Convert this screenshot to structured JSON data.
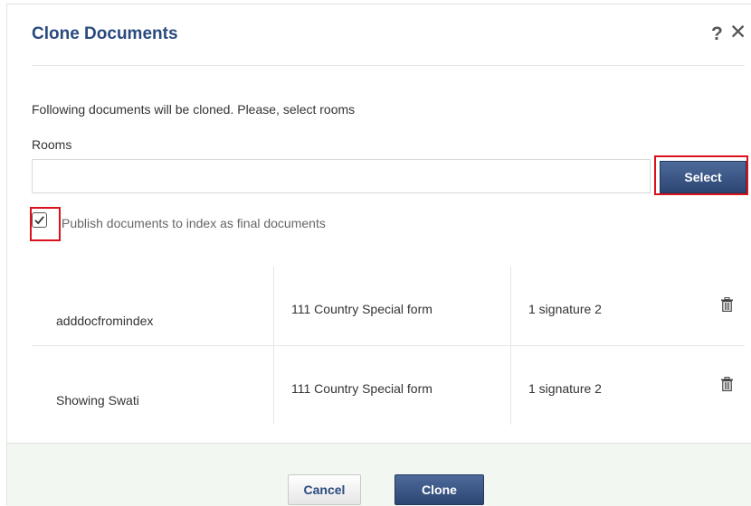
{
  "dialog": {
    "title": "Clone Documents",
    "help_glyph": "?",
    "close_glyph": "✕"
  },
  "instruction": "Following documents will be cloned. Please, select rooms",
  "rooms": {
    "label": "Rooms",
    "value": "",
    "placeholder": "",
    "select_label": "Select"
  },
  "publish": {
    "checked": true,
    "label": "Publish documents to index as final documents"
  },
  "documents": [
    {
      "name": "adddocfromindex",
      "form": "111 Country Special form",
      "signature": "1 signature 2",
      "icon": "trash-icon"
    },
    {
      "name": "Showing Swati",
      "form": "111 Country Special form",
      "signature": "1 signature 2",
      "icon": "trash-icon"
    }
  ],
  "footer": {
    "cancel_label": "Cancel",
    "clone_label": "Clone"
  },
  "colors": {
    "title": "#2a4a7e",
    "primary_button": "#2c4673",
    "highlight": "#d9121b",
    "footer_bg": "#f2f8f1"
  }
}
